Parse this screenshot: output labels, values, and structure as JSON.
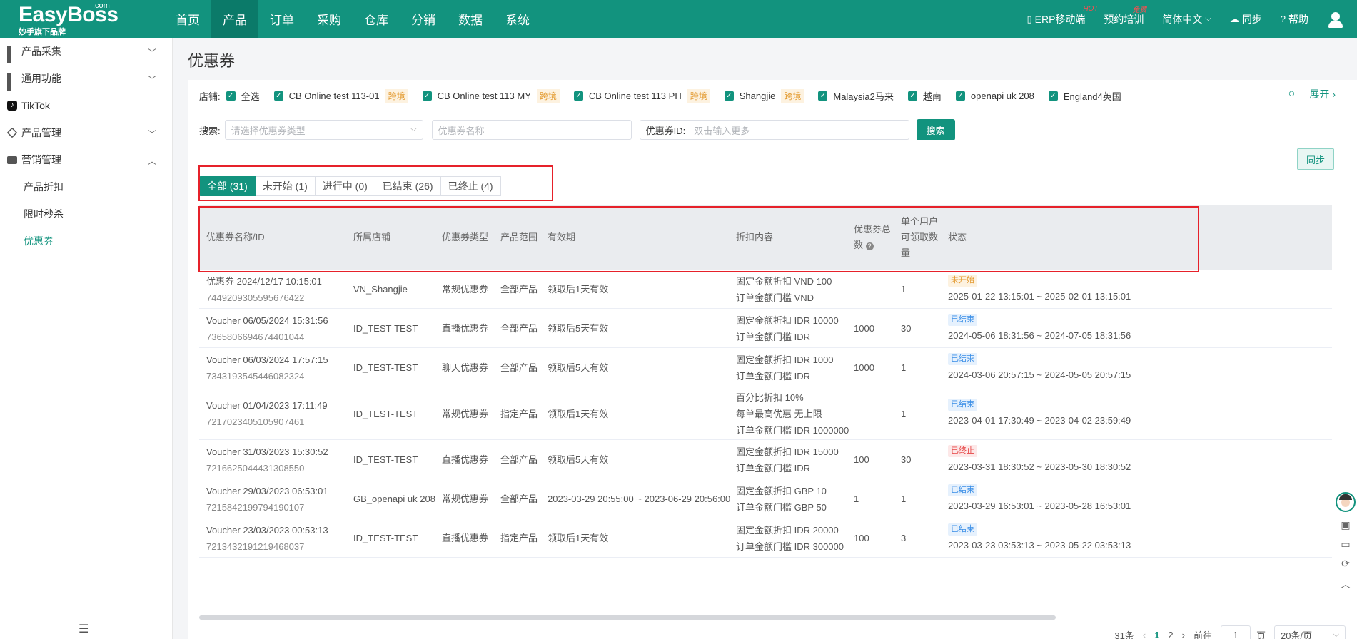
{
  "brand": {
    "name": "EasyBoss",
    "com": ".com",
    "tagline": "妙手旗下品牌"
  },
  "nav": [
    "首页",
    "产品",
    "订单",
    "采购",
    "仓库",
    "分销",
    "数据",
    "系统"
  ],
  "nav_active": "产品",
  "top_right": {
    "erp": "ERP移动端",
    "erp_badge": "HOT",
    "training": "预约培训",
    "training_badge": "免费",
    "language": "简体中文",
    "sync": "同步",
    "help": "帮助"
  },
  "sidebar": {
    "items": [
      {
        "label": "产品采集",
        "icon": "grid-icon",
        "expanded": false
      },
      {
        "label": "通用功能",
        "icon": "grid-icon",
        "expanded": false
      },
      {
        "label": "TikTok",
        "icon": "tiktok-icon",
        "expanded": null
      },
      {
        "label": "产品管理",
        "icon": "box-icon",
        "expanded": false
      },
      {
        "label": "营销管理",
        "icon": "marketing-icon",
        "expanded": true
      }
    ],
    "subitems": [
      "产品折扣",
      "限时秒杀",
      "优惠券"
    ],
    "active_sub": "优惠券"
  },
  "page": {
    "title": "优惠券"
  },
  "filters": {
    "store_label": "店铺:",
    "stores": [
      {
        "label": "全选",
        "tag": ""
      },
      {
        "label": "CB Online test 113-01",
        "tag": "跨境"
      },
      {
        "label": "CB Online test 113 MY",
        "tag": "跨境"
      },
      {
        "label": "CB Online test 113 PH",
        "tag": "跨境"
      },
      {
        "label": "Shangjie",
        "tag": "跨境"
      },
      {
        "label": "Malaysia2马来",
        "tag": ""
      },
      {
        "label": "越南",
        "tag": ""
      },
      {
        "label": "openapi uk 208",
        "tag": ""
      },
      {
        "label": "England4英国",
        "tag": ""
      }
    ],
    "expand": "展开",
    "search_label": "搜索:",
    "type_placeholder": "请选择优惠券类型",
    "name_placeholder": "优惠券名称",
    "id_label": "优惠券ID:",
    "id_placeholder": "双击输入更多",
    "search_button": "搜索",
    "sync_button": "同步"
  },
  "tabs": [
    "全部 (31)",
    "未开始 (1)",
    "进行中 (0)",
    "已结束 (26)",
    "已终止 (4)"
  ],
  "active_tab": 0,
  "table": {
    "columns": {
      "name": "优惠券名称/ID",
      "store": "所属店铺",
      "type": "优惠券类型",
      "range": "产品范围",
      "validity": "有效期",
      "discount": "折扣内容",
      "total": [
        "优惠券总",
        "数"
      ],
      "per_user": [
        "单个用户",
        "可领取数",
        "量"
      ],
      "status": "状态"
    },
    "rows": [
      {
        "name": "优惠券 2024/12/17 10:15:01",
        "id": "7449209305595676422",
        "store": "VN_Shangjie",
        "type": "常规优惠券",
        "range": "全部产品",
        "validity": "领取后1天有效",
        "discount": [
          "固定金额折扣 VND 100",
          "订单金额门槛 VND"
        ],
        "total": "",
        "per_user": "1",
        "status": "未开始",
        "status_color": "orange",
        "period": "2025-01-22 13:15:01 ~ 2025-02-01 13:15:01"
      },
      {
        "name": "Voucher 06/05/2024 15:31:56",
        "id": "7365806694674401044",
        "store": "ID_TEST-TEST",
        "type": "直播优惠券",
        "range": "全部产品",
        "validity": "领取后5天有效",
        "discount": [
          "固定金额折扣 IDR 10000",
          "订单金额门槛 IDR"
        ],
        "total": "1000",
        "per_user": "30",
        "status": "已结束",
        "status_color": "blue",
        "period": "2024-05-06 18:31:56 ~ 2024-07-05 18:31:56"
      },
      {
        "name": "Voucher 06/03/2024 17:57:15",
        "id": "7343193545446082324",
        "store": "ID_TEST-TEST",
        "type": "聊天优惠券",
        "range": "全部产品",
        "validity": "领取后5天有效",
        "discount": [
          "固定金额折扣 IDR 1000",
          "订单金额门槛 IDR"
        ],
        "total": "1000",
        "per_user": "1",
        "status": "已结束",
        "status_color": "blue",
        "period": "2024-03-06 20:57:15 ~ 2024-05-05 20:57:15"
      },
      {
        "name": "Voucher 01/04/2023 17:11:49",
        "id": "7217023405105907461",
        "store": "ID_TEST-TEST",
        "type": "常规优惠券",
        "range": "指定产品",
        "validity": "领取后1天有效",
        "discount": [
          "百分比折扣 10%",
          "每单最高优惠 无上限",
          "订单金额门槛 IDR 1000000"
        ],
        "total": "",
        "per_user": "1",
        "status": "已结束",
        "status_color": "blue",
        "period": "2023-04-01 17:30:49 ~ 2023-04-02 23:59:49"
      },
      {
        "name": "Voucher 31/03/2023 15:30:52",
        "id": "7216625044431308550",
        "store": "ID_TEST-TEST",
        "type": "直播优惠券",
        "range": "全部产品",
        "validity": "领取后5天有效",
        "discount": [
          "固定金额折扣 IDR 15000",
          "订单金额门槛 IDR"
        ],
        "total": "100",
        "per_user": "30",
        "status": "已终止",
        "status_color": "red",
        "period": "2023-03-31 18:30:52 ~ 2023-05-30 18:30:52"
      },
      {
        "name": "Voucher 29/03/2023 06:53:01",
        "id": "7215842199794190107",
        "store": "GB_openapi uk 208",
        "type": "常规优惠券",
        "range": "全部产品",
        "validity": "2023-03-29 20:55:00 ~ 2023-06-29 20:56:00",
        "discount": [
          "固定金额折扣 GBP 10",
          "订单金额门槛 GBP 50"
        ],
        "total": "1",
        "per_user": "1",
        "status": "已结束",
        "status_color": "blue",
        "period": "2023-03-29 16:53:01 ~ 2023-05-28 16:53:01"
      },
      {
        "name": "Voucher 23/03/2023 00:53:13",
        "id": "7213432191219468037",
        "store": "ID_TEST-TEST",
        "type": "直播优惠券",
        "range": "指定产品",
        "validity": "领取后1天有效",
        "discount": [
          "固定金额折扣 IDR 20000",
          "订单金额门槛 IDR 300000"
        ],
        "total": "100",
        "per_user": "3",
        "status": "已结束",
        "status_color": "blue",
        "period": "2023-03-23 03:53:13 ~ 2023-05-22 03:53:13"
      }
    ]
  },
  "pager": {
    "total": "31条",
    "pages": [
      "1",
      "2"
    ],
    "current": "1",
    "goto_label": "前往",
    "goto_value": "1",
    "page_unit": "页",
    "size": "20条/页"
  }
}
